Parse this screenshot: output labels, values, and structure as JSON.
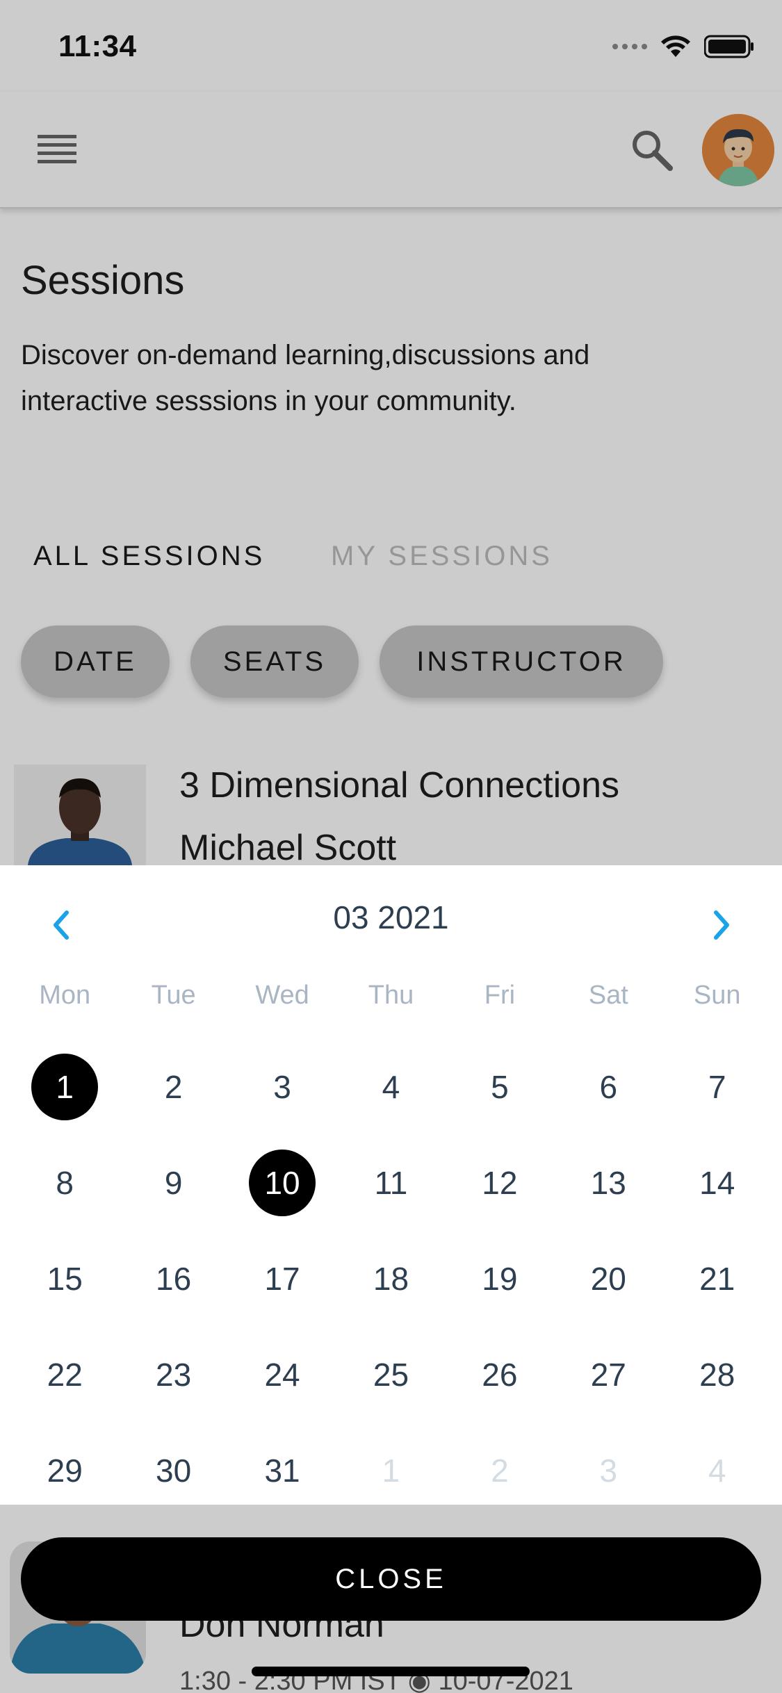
{
  "status_bar": {
    "time": "11:34"
  },
  "page": {
    "title": "Sessions",
    "description": "Discover on-demand learning,discussions and interactive sesssions in your community."
  },
  "tabs": [
    {
      "label": "ALL SESSIONS",
      "active": true
    },
    {
      "label": "MY SESSIONS",
      "active": false
    }
  ],
  "filters": [
    {
      "label": "DATE"
    },
    {
      "label": "SEATS"
    },
    {
      "label": "INSTRUCTOR"
    }
  ],
  "sessions": [
    {
      "title": "3 Dimensional Connections",
      "instructor": "Michael Scott"
    },
    {
      "instructor": "Don Norman",
      "time": "1:30 - 2:30 PM IST ◉ 10-07-2021"
    }
  ],
  "calendar": {
    "month_label": "03 2021",
    "weekdays": [
      "Mon",
      "Tue",
      "Wed",
      "Thu",
      "Fri",
      "Sat",
      "Sun"
    ],
    "weeks": [
      [
        {
          "d": "1",
          "sel": true
        },
        {
          "d": "2"
        },
        {
          "d": "3"
        },
        {
          "d": "4"
        },
        {
          "d": "5"
        },
        {
          "d": "6"
        },
        {
          "d": "7"
        }
      ],
      [
        {
          "d": "8"
        },
        {
          "d": "9"
        },
        {
          "d": "10",
          "sel": true
        },
        {
          "d": "11"
        },
        {
          "d": "12"
        },
        {
          "d": "13"
        },
        {
          "d": "14"
        }
      ],
      [
        {
          "d": "15"
        },
        {
          "d": "16"
        },
        {
          "d": "17"
        },
        {
          "d": "18"
        },
        {
          "d": "19"
        },
        {
          "d": "20"
        },
        {
          "d": "21"
        }
      ],
      [
        {
          "d": "22"
        },
        {
          "d": "23"
        },
        {
          "d": "24"
        },
        {
          "d": "25"
        },
        {
          "d": "26"
        },
        {
          "d": "27"
        },
        {
          "d": "28"
        }
      ],
      [
        {
          "d": "29"
        },
        {
          "d": "30"
        },
        {
          "d": "31"
        },
        {
          "d": "1",
          "muted": true
        },
        {
          "d": "2",
          "muted": true
        },
        {
          "d": "3",
          "muted": true
        },
        {
          "d": "4",
          "muted": true
        }
      ]
    ],
    "nav_color": "#1aa3e8"
  },
  "close_button": {
    "label": "CLOSE"
  }
}
